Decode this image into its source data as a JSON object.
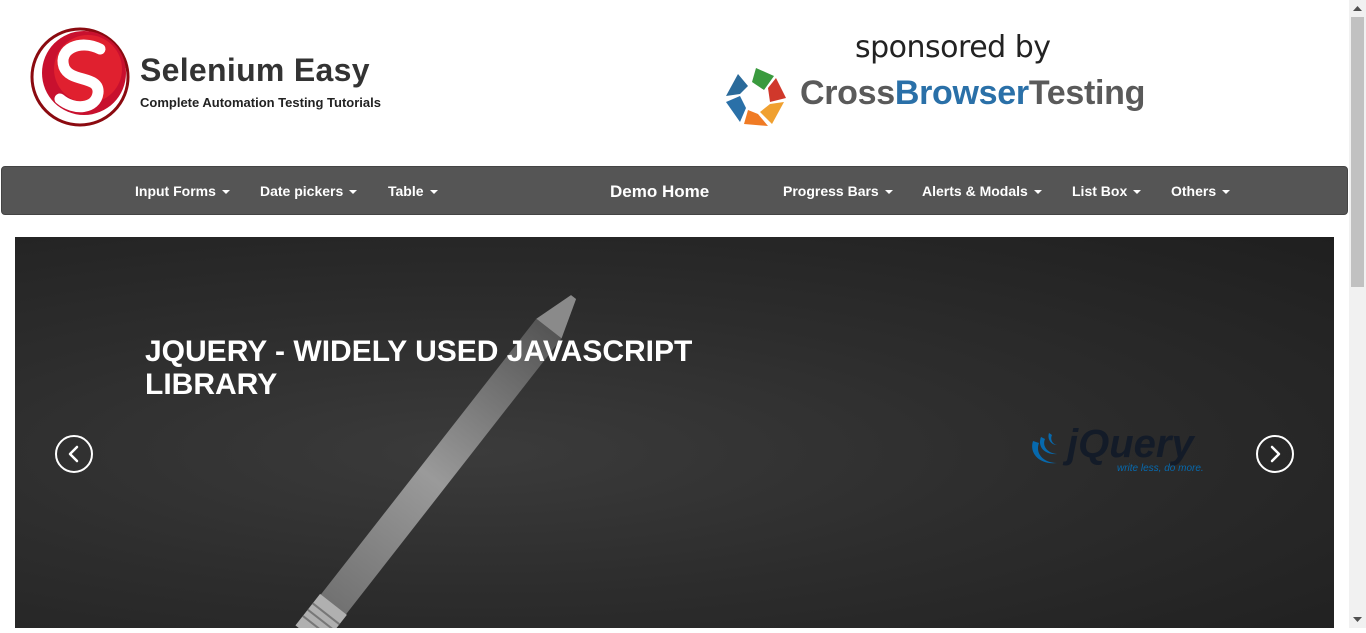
{
  "header": {
    "brand_title": "Selenium Easy",
    "brand_subtitle": "Complete Automation Testing Tutorials",
    "sponsored": "sponsored by",
    "sponsor_name_parts": [
      "Cross",
      "Browser",
      "Testing"
    ]
  },
  "nav": {
    "left": [
      {
        "label": "Input Forms",
        "has_caret": true
      },
      {
        "label": "Date pickers",
        "has_caret": true
      },
      {
        "label": "Table",
        "has_caret": true
      }
    ],
    "center": {
      "label": "Demo Home"
    },
    "right": [
      {
        "label": "Progress Bars",
        "has_caret": true
      },
      {
        "label": "Alerts & Modals",
        "has_caret": true
      },
      {
        "label": "List Box",
        "has_caret": true
      },
      {
        "label": "Others",
        "has_caret": true
      }
    ]
  },
  "carousel": {
    "slide_title": "JQUERY - WIDELY USED JAVASCRIPT LIBRARY",
    "prev_icon": "chevron-left-icon",
    "next_icon": "chevron-right-icon",
    "logo_text": "jQuery",
    "logo_tagline": "write less, do more."
  },
  "colors": {
    "navbar": "#555555",
    "brand_red": "#c8102e",
    "sponsor_blue": "#2a70a8",
    "jquery_blue": "#0769ad"
  }
}
